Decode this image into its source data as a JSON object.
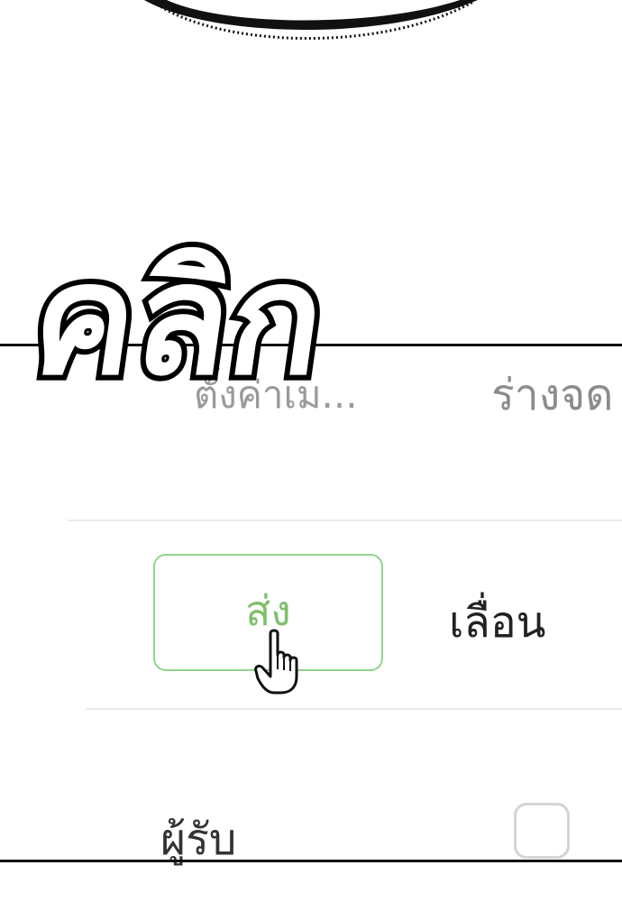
{
  "sound_effect": "คลิก",
  "tabs": {
    "left_label": "ตั้งค่าเม...",
    "right_label": "ร่างจด"
  },
  "actions": {
    "send_label": "ส่ง",
    "scroll_label": "เลื่อน"
  },
  "receiver": {
    "label": "ผู้รับ"
  },
  "colors": {
    "send_accent": "#7fbf6a",
    "border": "#111111"
  },
  "icons": {
    "cursor": "hand-pointer-icon",
    "checkbox": "checkbox-icon"
  }
}
